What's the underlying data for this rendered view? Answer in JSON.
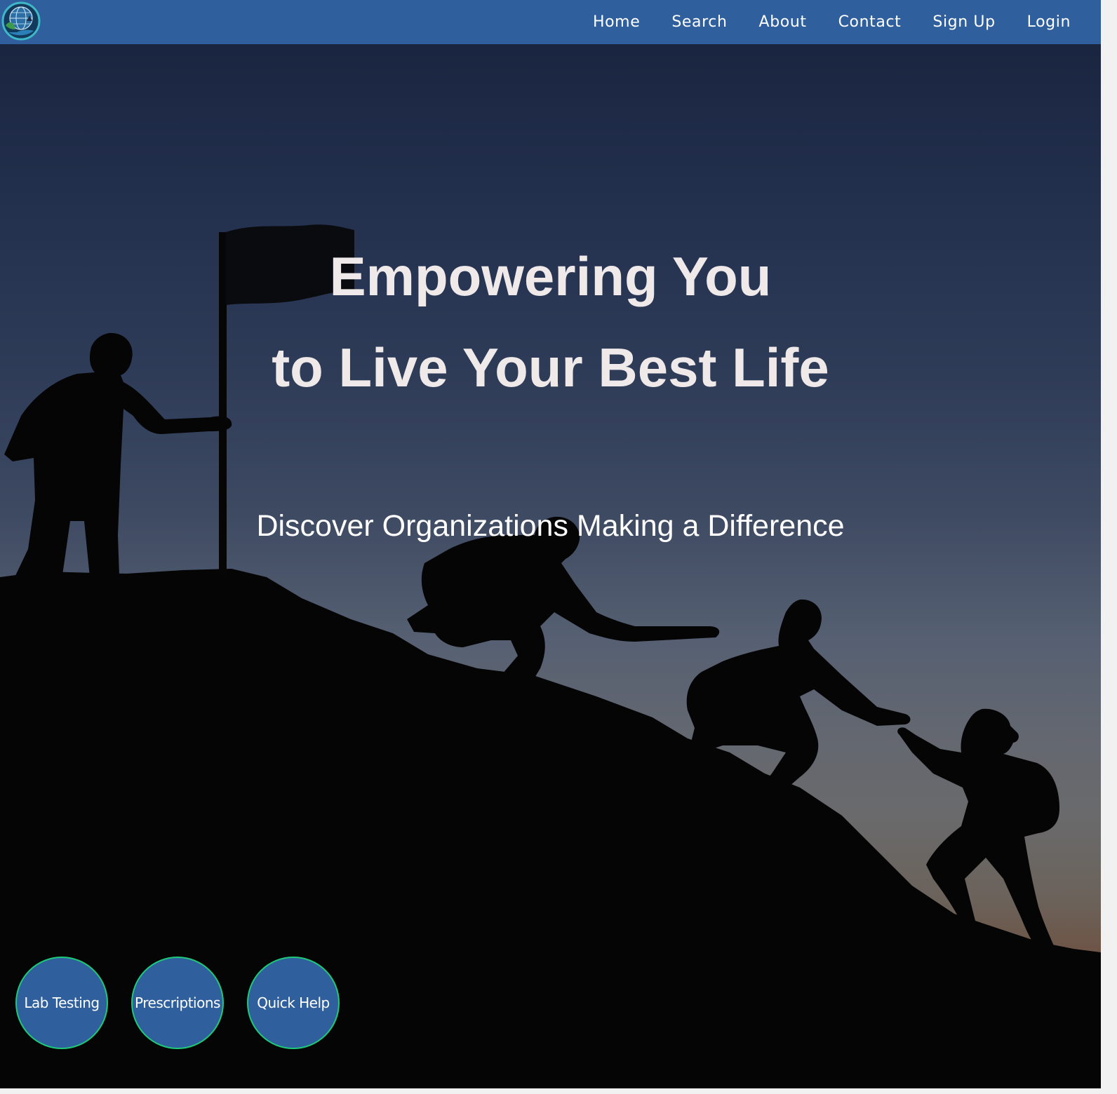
{
  "nav": {
    "logo_icon": "globe-leaf-logo-icon",
    "links": [
      {
        "label": "Home"
      },
      {
        "label": "Search"
      },
      {
        "label": "About"
      },
      {
        "label": "Contact"
      },
      {
        "label": "Sign Up"
      },
      {
        "label": "Login"
      }
    ]
  },
  "hero": {
    "headline_line1": "Empowering You",
    "headline_line2": "to Live Your Best Life",
    "subheadline": "Discover Organizations Making a Difference",
    "background_image": "mountain-climbers-silhouette"
  },
  "quick_actions": [
    {
      "label": "Lab Testing"
    },
    {
      "label": "Prescriptions"
    },
    {
      "label": "Quick Help"
    }
  ],
  "colors": {
    "brand_blue": "#2f609d",
    "button_border": "#1fc97a",
    "headline_text": "#efe9ea"
  }
}
